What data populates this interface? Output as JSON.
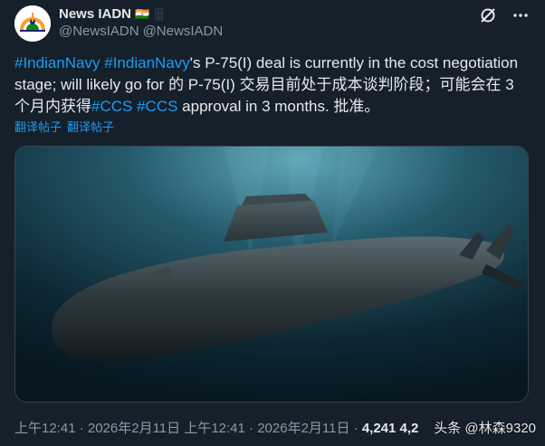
{
  "author": {
    "display_name": "News IADN",
    "handle": "@NewsIADN",
    "handle_repeat": "@NewsIADN"
  },
  "tweet": {
    "hashtag_1": "#IndianNavy",
    "hashtag_2": "#IndianNavy",
    "text_1": "'s P-75(I) deal is currently in the cost negotiation stage; will likely go for  的 P-75(I) 交易目前处于成本谈判阶段；可能会在 3 个月内获得",
    "hashtag_3": "#CCS",
    "hashtag_4": "#CCS",
    "text_2": " approval in 3 months. 批准。"
  },
  "translate": {
    "link_1": "翻译帖子",
    "link_2": "翻译帖子"
  },
  "meta": {
    "time_1": "上午12:41 · 2026年2月11日",
    "time_2": "上午12:41 · 2026年2月11日",
    "separator": " · ",
    "views_num": "4,241",
    "views_label": " 4,2"
  },
  "watermark": "头条 @林森9320",
  "icons": {
    "avatar": "india-flag-logo",
    "grok": "grok-icon",
    "more": "more-icon"
  }
}
